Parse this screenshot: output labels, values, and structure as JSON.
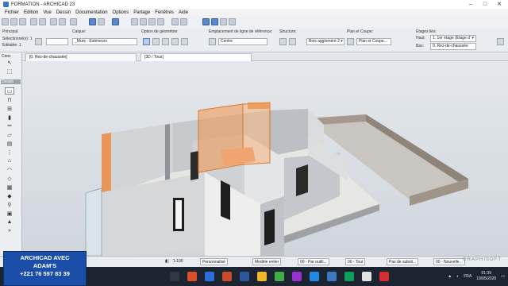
{
  "window": {
    "title": "FORMATION - ARCHICAD 23"
  },
  "menu": [
    "Fichier",
    "Edition",
    "Vue",
    "Dessin",
    "Documentation",
    "Options",
    "Partage",
    "Fenêtres",
    "Aide"
  ],
  "infobox": {
    "principal_label": "Principal:",
    "selection_label": "Sélectionné(s): 1",
    "editable_label": "Éditable: 1",
    "calque_label": "Calque:",
    "calque_value": "_Murs - Extérieurs",
    "geometry_label": "Option de géométrie:",
    "ref_line_label": "Emplacement de ligne de référence:",
    "ref_line_value": "Centre",
    "structure_label": "Structure:",
    "structure_value": "Bois aggloméré 2 ▾",
    "plan_coupe_label": "Plan et Coupe:",
    "plan_coupe_value": "Plan et Coupe...",
    "etages_label": "Étages liés:",
    "haut_label": "Haut:",
    "haut_value": "1. 1er étage (Étage d' ▾",
    "bas_label": "Bas:",
    "bas_value": "0. Rez-de-chaussée"
  },
  "tabs": {
    "plan": "[0. Rez-de-chaussée]",
    "view3d": "[3D / Tous]"
  },
  "toolbox": {
    "head": "Conc",
    "section": "Dessin",
    "tools": [
      "pointer-icon",
      "marquee-icon",
      "wall-icon",
      "door-icon",
      "window-icon",
      "column-icon",
      "beam-icon",
      "slab-icon",
      "stair-icon",
      "railing-icon",
      "roof-icon",
      "shell-icon",
      "skylight-icon",
      "curtain-wall-icon",
      "morph-icon",
      "object-icon",
      "zone-icon",
      "mesh-icon",
      "more-icon"
    ]
  },
  "statusbar": {
    "scale_value": "1:100",
    "pen_value": "Personnalisé",
    "model_value": "Modèle entier",
    "override_value": "00 - Par outili...",
    "layer_combo_value": "00 - Tout",
    "renovation_value": "Pas de substi...",
    "filter_value": "00 - Nouvelle...",
    "brand": "GRAPHISOFT"
  },
  "taskbar": {
    "search_placeholder": "Taper ici pour rechercher",
    "lang": "FRA",
    "time": "01:39",
    "date": "19/05/2020"
  },
  "promo": {
    "line1": "ARCHICAD AVEC",
    "line2": "ADAM'S",
    "line3": "+221 76 597 83 39"
  },
  "colors": {
    "wall_gray": "#bfc3c7",
    "selection_orange": "#f2944a",
    "terrace_wall": "#9e9287",
    "accent_blue": "#3f78c2"
  }
}
